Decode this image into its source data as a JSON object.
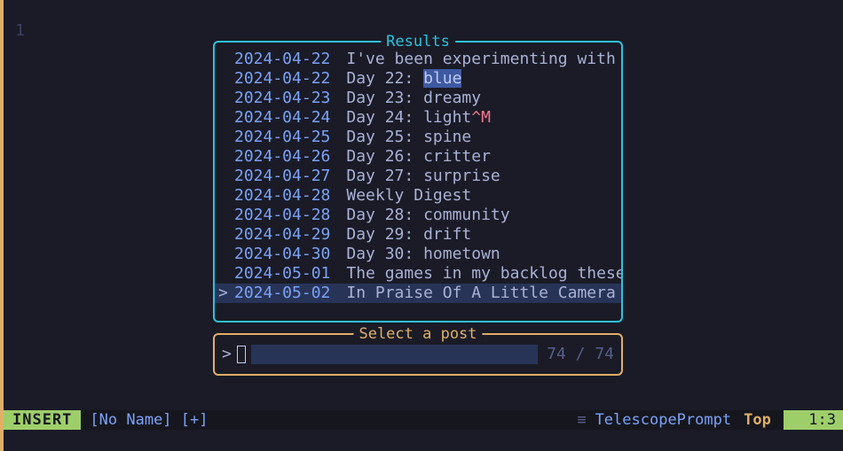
{
  "gutter_line": "1",
  "results": {
    "title": "Results",
    "items": [
      {
        "date": "2024-04-22",
        "content": "I've been experimenting with [this a"
      },
      {
        "date": "2024-04-22",
        "content": "Day 22: ",
        "hl": "blue"
      },
      {
        "date": "2024-04-23",
        "content": "Day 23: dreamy"
      },
      {
        "date": "2024-04-24",
        "content": "Day 24: light",
        "ctrl": "^M"
      },
      {
        "date": "2024-04-25",
        "content": "Day 25: spine"
      },
      {
        "date": "2024-04-26",
        "content": "Day 26: critter"
      },
      {
        "date": "2024-04-27",
        "content": "Day 27: surprise"
      },
      {
        "date": "2024-04-28",
        "content": "Weekly Digest"
      },
      {
        "date": "2024-04-28",
        "content": "Day 28: community"
      },
      {
        "date": "2024-04-29",
        "content": "Day 29: drift"
      },
      {
        "date": "2024-04-30",
        "content": "Day 30: hometown"
      },
      {
        "date": "2024-05-01",
        "content": "The games in my backlog these days a"
      },
      {
        "date": "2024-05-02",
        "content": "In Praise Of A Little Camera",
        "selected": true
      }
    ]
  },
  "prompt": {
    "title": "Select a post",
    "chev": ">",
    "counter": "74 / 74"
  },
  "status": {
    "mode": "INSERT",
    "filename": "[No Name] [+]",
    "filetype": "TelescopePrompt",
    "scroll": "Top",
    "pos": "  1:3"
  }
}
